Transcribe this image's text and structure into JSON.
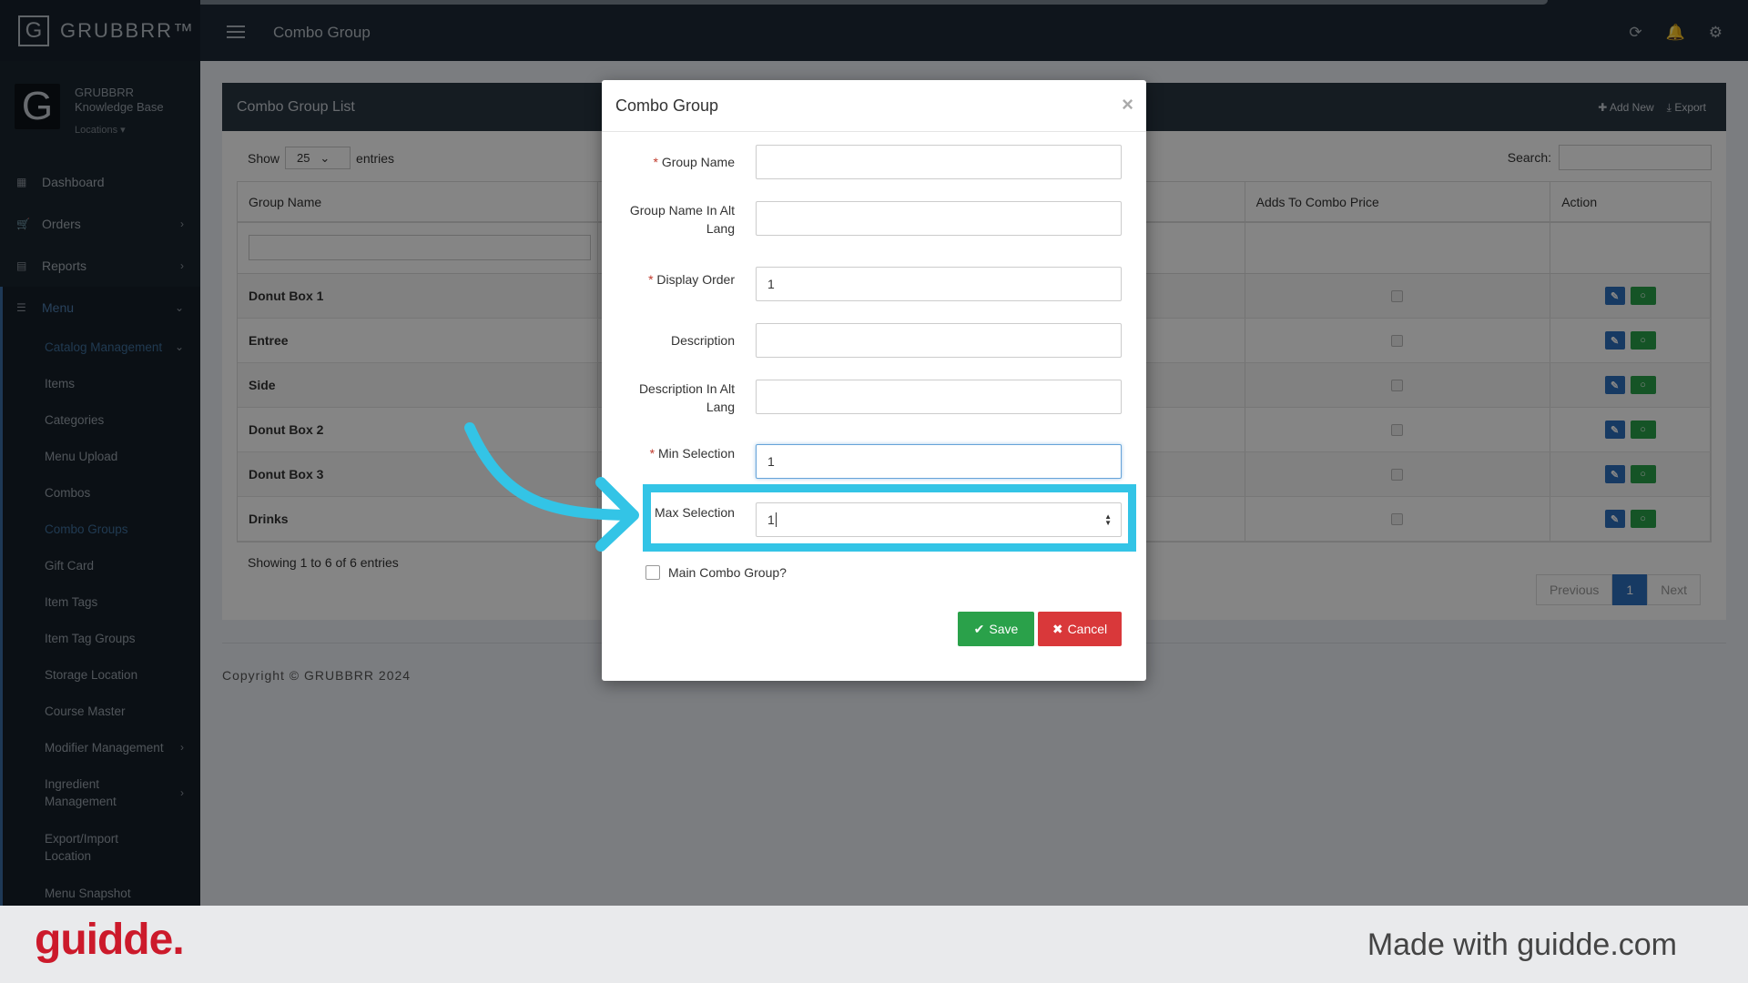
{
  "app": {
    "brand": "GRUBBRR™",
    "page_title": "Combo Group"
  },
  "user": {
    "name": "GRUBBRR Knowledge Base",
    "locations": "Locations ▾"
  },
  "sidebar": {
    "items": [
      {
        "label": "Dashboard",
        "icon": "dashboard-icon"
      },
      {
        "label": "Orders",
        "icon": "cart-icon"
      },
      {
        "label": "Reports",
        "icon": "report-icon"
      },
      {
        "label": "Menu",
        "icon": "menu-icon"
      }
    ],
    "menu_sub": [
      "Catalog Management",
      "Items",
      "Categories",
      "Menu Upload",
      "Combos",
      "Combo Groups",
      "Gift Card",
      "Item Tags",
      "Item Tag Groups",
      "Storage Location",
      "Course Master",
      "Modifier Management",
      "Ingredient Management",
      "Export/Import Location",
      "Menu Snapshot"
    ]
  },
  "panel": {
    "title": "Combo Group List",
    "add_new": "Add New",
    "export": "Export",
    "show_label": "Show",
    "entries_value": "25",
    "entries_label": "entries",
    "search_label": "Search:",
    "columns": [
      "Group Name",
      "",
      "Adds To Combo Price",
      "Action"
    ],
    "rows": [
      "Donut Box 1",
      "Entree",
      "Side",
      "Donut Box 2",
      "Donut Box 3",
      "Drinks"
    ],
    "showing": "Showing 1 to 6 of 6 entries",
    "pager": {
      "previous": "Previous",
      "page": "1",
      "next": "Next"
    }
  },
  "copyright": "Copyright © GRUBBRR 2024",
  "modal": {
    "title": "Combo Group",
    "fields": {
      "group_name": {
        "label": "Group Name",
        "value": ""
      },
      "group_name_alt": {
        "label": "Group Name In Alt Lang",
        "value": ""
      },
      "display_order": {
        "label": "Display Order",
        "value": "1"
      },
      "description": {
        "label": "Description",
        "value": ""
      },
      "description_alt": {
        "label": "Description In Alt Lang",
        "value": ""
      },
      "min_selection": {
        "label": "Min Selection",
        "value": "1"
      },
      "max_selection": {
        "label": "Max Selection",
        "value": "1"
      }
    },
    "main_combo_label": "Main Combo Group?",
    "save": "Save",
    "cancel": "Cancel"
  },
  "colors": {
    "highlight": "#33c4e6",
    "save": "#2aa14a",
    "cancel": "#d9383a",
    "guidde": "#cc1a2b"
  },
  "footer": {
    "logo": "guidde.",
    "made_with": "Made with guidde.com"
  }
}
